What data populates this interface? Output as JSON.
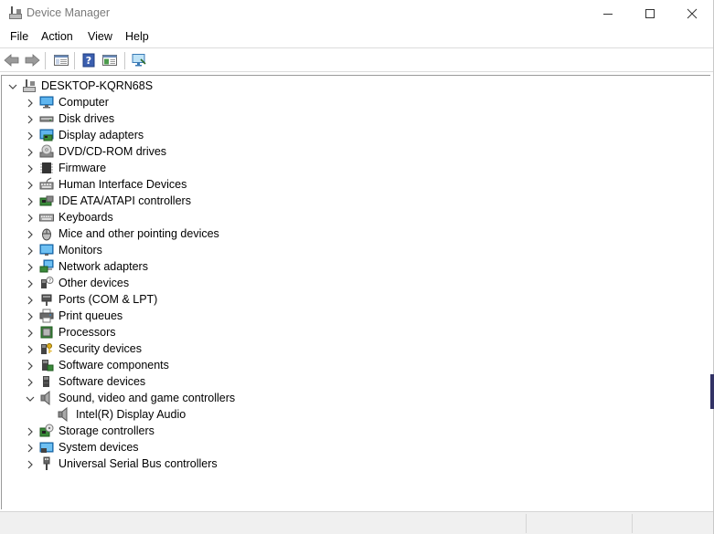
{
  "window": {
    "title": "Device Manager"
  },
  "menu": {
    "file": "File",
    "action": "Action",
    "view": "View",
    "help": "Help"
  },
  "tree": {
    "root": "DESKTOP-KQRN68S",
    "items": [
      {
        "label": "Computer",
        "icon": "computer-icon"
      },
      {
        "label": "Disk drives",
        "icon": "disk-drive-icon"
      },
      {
        "label": "Display adapters",
        "icon": "display-adapter-icon"
      },
      {
        "label": "DVD/CD-ROM drives",
        "icon": "dvd-drive-icon"
      },
      {
        "label": "Firmware",
        "icon": "firmware-chip-icon"
      },
      {
        "label": "Human Interface Devices",
        "icon": "hid-icon"
      },
      {
        "label": "IDE ATA/ATAPI controllers",
        "icon": "ide-controller-icon"
      },
      {
        "label": "Keyboards",
        "icon": "keyboard-icon"
      },
      {
        "label": "Mice and other pointing devices",
        "icon": "mouse-icon"
      },
      {
        "label": "Monitors",
        "icon": "monitor-icon"
      },
      {
        "label": "Network adapters",
        "icon": "network-adapter-icon"
      },
      {
        "label": "Other devices",
        "icon": "unknown-device-icon"
      },
      {
        "label": "Ports (COM & LPT)",
        "icon": "port-icon"
      },
      {
        "label": "Print queues",
        "icon": "printer-icon"
      },
      {
        "label": "Processors",
        "icon": "processor-icon"
      },
      {
        "label": "Security devices",
        "icon": "security-device-icon"
      },
      {
        "label": "Software components",
        "icon": "software-component-icon"
      },
      {
        "label": "Software devices",
        "icon": "software-device-icon"
      },
      {
        "label": "Sound, video and game controllers",
        "icon": "speaker-icon",
        "expanded": true
      },
      {
        "label": "Intel(R) Display Audio",
        "icon": "speaker-icon",
        "child": true
      },
      {
        "label": "Storage controllers",
        "icon": "storage-controller-icon"
      },
      {
        "label": "System devices",
        "icon": "system-device-icon"
      },
      {
        "label": "Universal Serial Bus controllers",
        "icon": "usb-icon"
      }
    ]
  }
}
